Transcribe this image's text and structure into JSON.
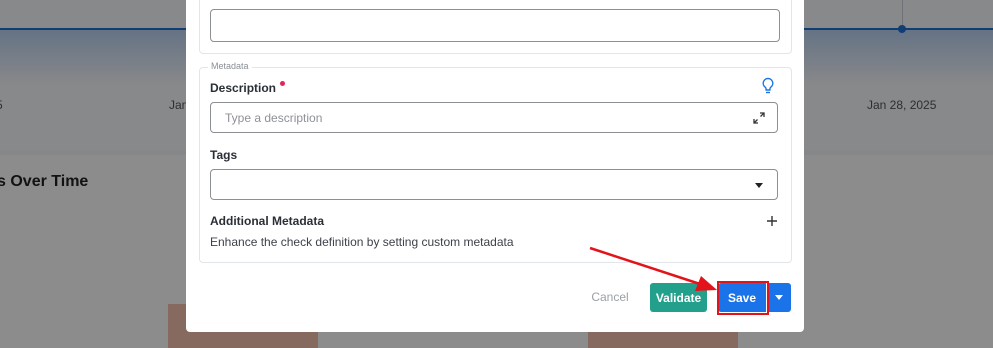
{
  "background": {
    "ticks": [
      "5",
      "Jan",
      "Jan 28, 2025"
    ],
    "section_title": "s Over Time"
  },
  "modal": {
    "top_input_value": "",
    "metadata": {
      "legend": "Metadata",
      "description": {
        "label": "Description",
        "value": "",
        "placeholder": "Type a description"
      },
      "tags": {
        "label": "Tags",
        "value": ""
      },
      "additional": {
        "label": "Additional Metadata",
        "helper": "Enhance the check definition by setting custom metadata"
      }
    },
    "footer": {
      "cancel_label": "Cancel",
      "validate_label": "Validate",
      "save_label": "Save"
    }
  },
  "colors": {
    "accent": "#1a73e8",
    "validate": "#23a08c",
    "required": "#e0265a",
    "annotation": "#e3131b"
  },
  "icons": [
    "lightbulb-icon",
    "expand-icon",
    "chevron-down-icon",
    "plus-icon"
  ]
}
